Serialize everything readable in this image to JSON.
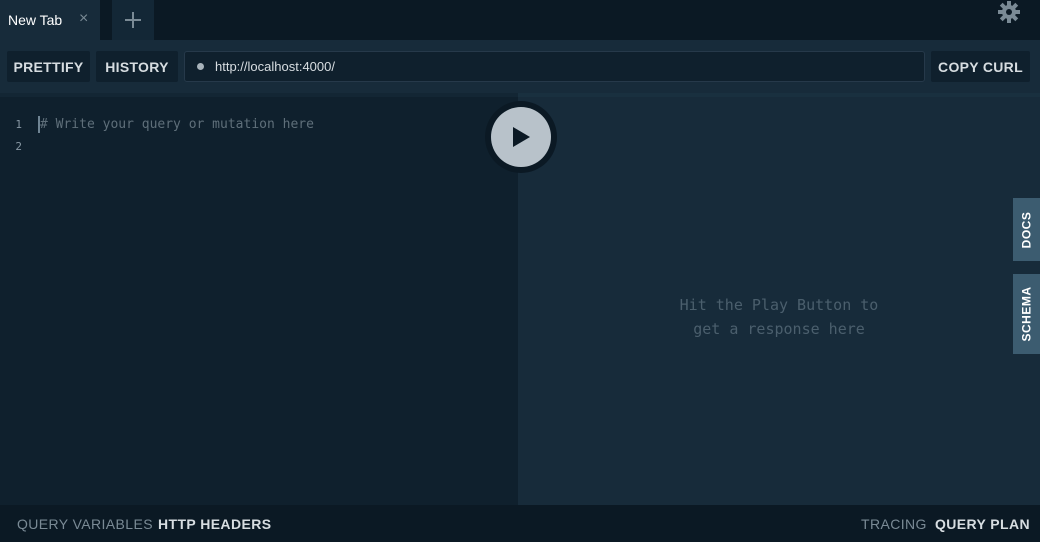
{
  "tabs": [
    {
      "title": "New Tab",
      "close_glyph": "×"
    }
  ],
  "tab_add": {
    "icon": "plus-icon"
  },
  "settings": {
    "icon": "gear-icon"
  },
  "toolbar": {
    "prettify_label": "PRETTIFY",
    "history_label": "HISTORY",
    "endpoint_url": "http://localhost:4000/",
    "copy_curl_label": "COPY CURL"
  },
  "editor": {
    "line_numbers": [
      "1",
      "2"
    ],
    "lines": [
      "# Write your query or mutation here",
      ""
    ]
  },
  "play_button": {
    "icon": "play-icon"
  },
  "result": {
    "hint_line1": "Hit the Play Button to",
    "hint_line2": "get a response here"
  },
  "side_tabs": {
    "docs_label": "DOCS",
    "schema_label": "SCHEMA"
  },
  "bottom_bar": {
    "query_variables_label": "QUERY VARIABLES",
    "http_headers_label": "HTTP HEADERS",
    "tracing_label": "TRACING",
    "query_plan_label": "QUERY PLAN"
  },
  "colors": {
    "background": "#0f202d",
    "panel": "#172b3a",
    "bar_dark": "#0b1924",
    "side_tab": "#3c5c70",
    "play_button": "#b8c2ca"
  }
}
